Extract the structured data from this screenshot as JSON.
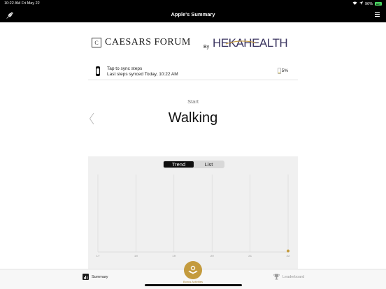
{
  "status_bar": {
    "time_date": "10:22 AM   Fri May 22",
    "battery_pct": "96%",
    "battery_badge": "BAT"
  },
  "nav": {
    "title": "Apple's Summary",
    "left_icon": "plug-icon",
    "right_icon": "menu-icon"
  },
  "branding": {
    "caesars_mark": "C",
    "caesars": "CAESARS FORUM",
    "by": "By",
    "heka": "HEKAHEALTH"
  },
  "sync": {
    "line1": "Tap to sync steps",
    "line2": "Last steps synced Today, 10:22 AM",
    "battery_pct": "5%",
    "battery_level": 0.05
  },
  "activity": {
    "start_label": "Start",
    "name": "Walking"
  },
  "view_toggle": {
    "options": [
      "Trend",
      "List"
    ],
    "selected": "Trend"
  },
  "chart_data": {
    "type": "scatter",
    "x": [
      "17",
      "18",
      "19",
      "20",
      "21",
      "22"
    ],
    "values": [
      0,
      0,
      0,
      0,
      0,
      0
    ],
    "highlight_x": "22",
    "color": "#c49b3e",
    "grid": true
  },
  "tabbar": {
    "summary_label": "Summary",
    "bonus_label": "Bonus Activities",
    "leaderboard_label": "Leaderboard",
    "accent": "#c49b3e"
  }
}
